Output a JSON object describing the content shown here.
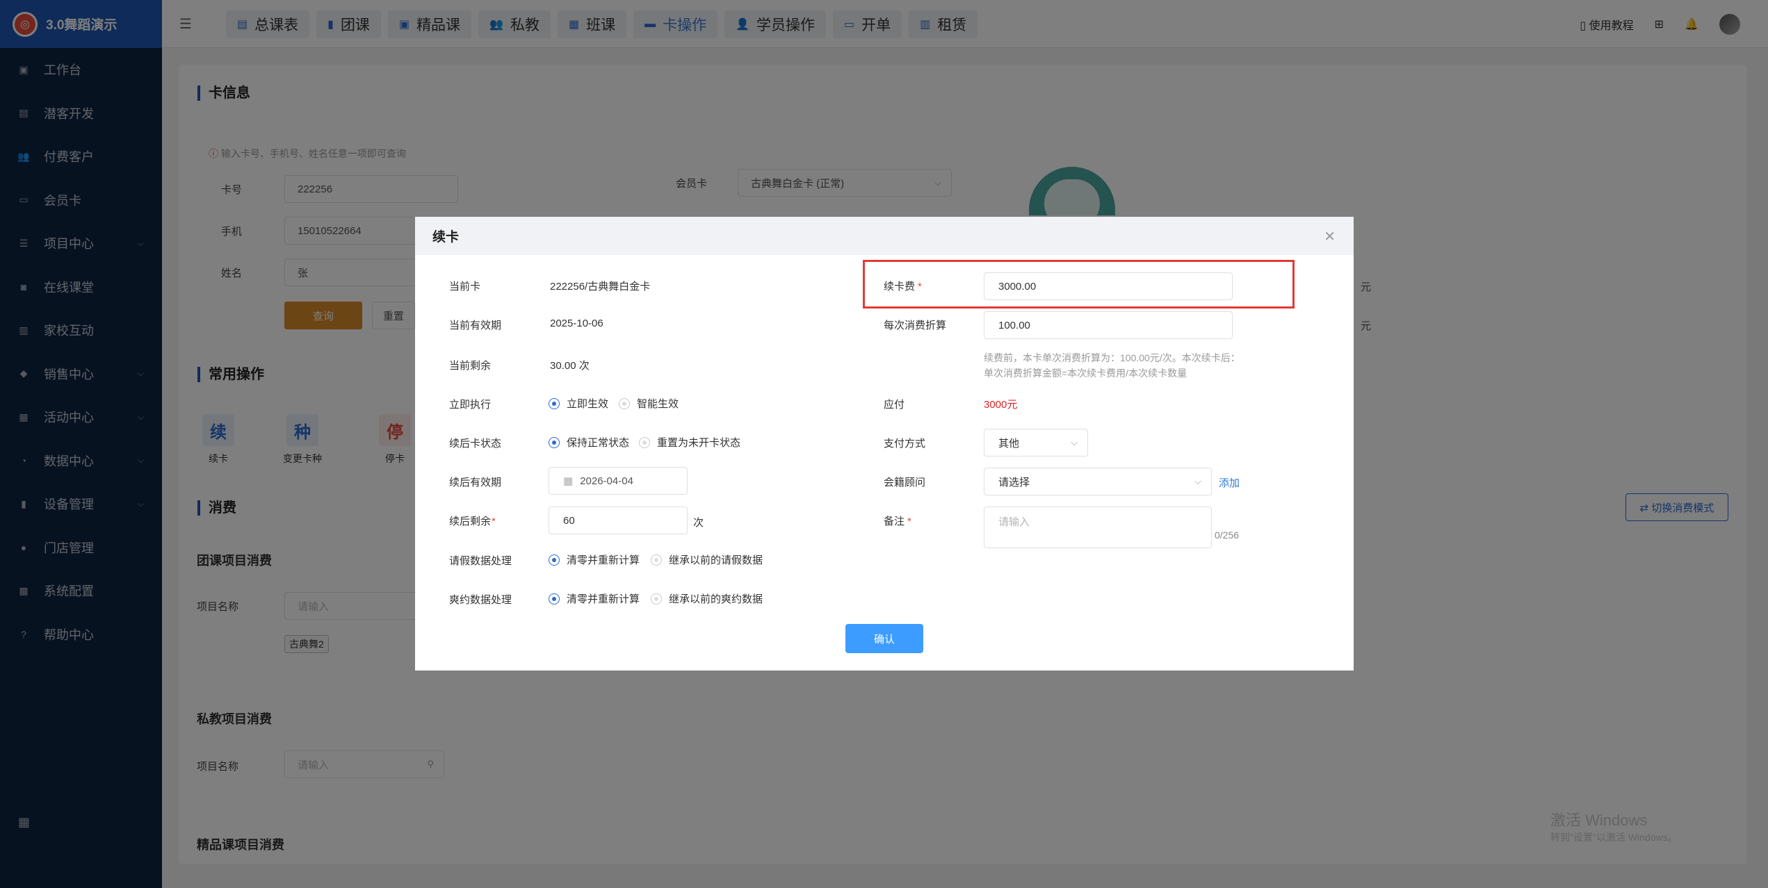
{
  "app": {
    "title": "3.0舞蹈演示"
  },
  "sidebar": {
    "items": [
      {
        "label": "工作台",
        "icon": "image-icon",
        "glyph": "▣",
        "chev": false
      },
      {
        "label": "潜客开发",
        "icon": "id-card-icon",
        "glyph": "▤",
        "chev": false
      },
      {
        "label": "付费客户",
        "icon": "users-icon",
        "glyph": "👥",
        "chev": false
      },
      {
        "label": "会员卡",
        "icon": "wallet-icon",
        "glyph": "▭",
        "chev": false
      },
      {
        "label": "项目中心",
        "icon": "list-icon",
        "glyph": "☰",
        "chev": true
      },
      {
        "label": "在线课堂",
        "icon": "camera-icon",
        "glyph": "◙",
        "chev": false
      },
      {
        "label": "家校互动",
        "icon": "contact-icon",
        "glyph": "▥",
        "chev": false
      },
      {
        "label": "销售中心",
        "icon": "tag-icon",
        "glyph": "◆",
        "chev": true
      },
      {
        "label": "活动中心",
        "icon": "activity-icon",
        "glyph": "▦",
        "chev": true
      },
      {
        "label": "数据中心",
        "icon": "pie-chart-icon",
        "glyph": "◔",
        "chev": true
      },
      {
        "label": "设备管理",
        "icon": "books-icon",
        "glyph": "▮",
        "chev": true
      },
      {
        "label": "门店管理",
        "icon": "circle-icon",
        "glyph": "●",
        "chev": false
      },
      {
        "label": "系统配置",
        "icon": "monitor-icon",
        "glyph": "▩",
        "chev": false
      },
      {
        "label": "帮助中心",
        "icon": "help-icon",
        "glyph": "?",
        "chev": false
      }
    ]
  },
  "topbar": {
    "tabs": [
      {
        "label": "总课表",
        "icon": "table-icon",
        "glyph": "▤"
      },
      {
        "label": "团课",
        "icon": "book-icon",
        "glyph": "▮"
      },
      {
        "label": "精品课",
        "icon": "star-book-icon",
        "glyph": "▣"
      },
      {
        "label": "私教",
        "icon": "users-icon",
        "glyph": "👥"
      },
      {
        "label": "班课",
        "icon": "board-icon",
        "glyph": "▦"
      },
      {
        "label": "卡操作",
        "icon": "card-icon",
        "glyph": "▬"
      },
      {
        "label": "学员操作",
        "icon": "user-icon",
        "glyph": "👤"
      },
      {
        "label": "开单",
        "icon": "order-icon",
        "glyph": "▭"
      },
      {
        "label": "租赁",
        "icon": "building-icon",
        "glyph": "▥"
      }
    ],
    "active_tab": "卡操作",
    "tutorial": "使用教程"
  },
  "card_info": {
    "title": "卡信息",
    "hint": "输入卡号、手机号、姓名任意一项即可查询",
    "card_no_label": "卡号",
    "card_no": "222256",
    "phone_label": "手机",
    "phone": "15010522664",
    "name_label": "姓名",
    "name": "张",
    "query_btn": "查询",
    "reset_btn": "重置",
    "member_card_label": "会员卡",
    "member_card_value": "古典舞白金卡 (正常)",
    "yuan1": "元",
    "yuan2": "元"
  },
  "common_ops": {
    "title": "常用操作",
    "items": [
      {
        "glyph": "续",
        "label": "续卡",
        "color": "#2d6ad1",
        "bg": "#e8f0fb"
      },
      {
        "glyph": "种",
        "label": "变更卡种",
        "color": "#2d6ad1",
        "bg": "#e8f0fb"
      },
      {
        "glyph": "停",
        "label": "停卡",
        "color": "#e04a3f",
        "bg": "#fdeceb"
      }
    ]
  },
  "consume": {
    "title": "消费",
    "switch_btn": "⇄ 切换消费模式",
    "group_title": "团课项目消费",
    "item_name_label": "项目名称",
    "placeholder": "请输入",
    "group_tag": "古典舞2",
    "private_title": "私教项目消费",
    "premium_title": "精品课项目消费"
  },
  "watermark": {
    "line1": "激活 Windows",
    "line2": "转到\"设置\"以激活 Windows。"
  },
  "modal": {
    "title": "续卡",
    "left": {
      "current_card_label": "当前卡",
      "current_card": "222256/古典舞白金卡",
      "current_expiry_label": "当前有效期",
      "current_expiry": "2025-10-06",
      "current_remain_label": "当前剩余",
      "current_remain": "30.00 次",
      "execute_label": "立即执行",
      "execute_opt1": "立即生效",
      "execute_opt2": "智能生效",
      "after_status_label": "续后卡状态",
      "after_status_opt1": "保持正常状态",
      "after_status_opt2": "重置为未开卡状态",
      "after_expiry_label": "续后有效期",
      "after_expiry": "2026-04-04",
      "after_remain_label": "续后剩余",
      "after_remain": "60",
      "after_remain_unit": "次",
      "leave_label": "请假数据处理",
      "leave_opt1": "清零并重新计算",
      "leave_opt2": "继承以前的请假数据",
      "noshow_label": "爽约数据处理",
      "noshow_opt1": "清零并重新计算",
      "noshow_opt2": "继承以前的爽约数据"
    },
    "right": {
      "fee_label": "续卡费",
      "fee": "3000.00",
      "discount_label": "每次消费折算",
      "discount": "100.00",
      "hint1": "续费前，本卡单次消费折算为：100.00元/次。本次续卡后：",
      "hint2": "单次消费折算金额=本次续卡费用/本次续卡数量",
      "payable_label": "应付",
      "payable": "3000元",
      "pay_method_label": "支付方式",
      "pay_method": "其他",
      "advisor_label": "会籍顾问",
      "advisor_placeholder": "请选择",
      "add_link": "添加",
      "remark_label": "备注",
      "remark_placeholder": "请输入",
      "remark_count": "0/256"
    },
    "confirm": "确认"
  }
}
